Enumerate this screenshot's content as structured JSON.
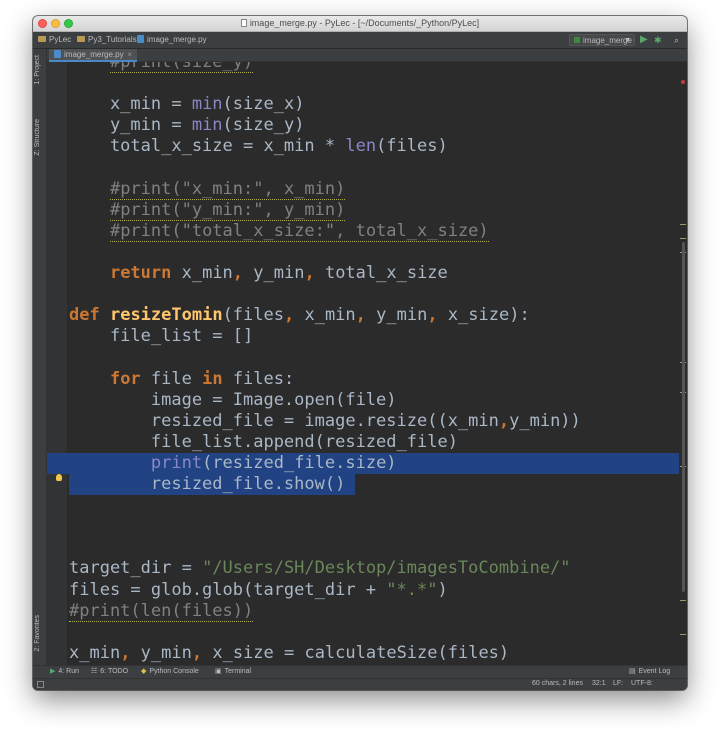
{
  "window": {
    "title": "image_merge.py - PyLec - [~/Documents/_Python/PyLec]"
  },
  "navbar": {
    "crumbs": [
      "PyLec",
      "Py3_Tutorials",
      "image_merge.py"
    ],
    "run_config": "image_merge"
  },
  "tabs": [
    {
      "label": "image_merge.py",
      "close": "×"
    }
  ],
  "left_tools": [
    {
      "label": "1: Project"
    },
    {
      "label": "Z: Structure"
    },
    {
      "label": "2: Favorites"
    }
  ],
  "editor": {
    "lines": [
      {
        "id": "l0",
        "html": "    <span class=\"cm sq\">#print(size_y)</span>"
      },
      {
        "id": "l1",
        "html": ""
      },
      {
        "id": "l2",
        "html": "    x_min = <span class=\"bi\">min</span>(size_x)"
      },
      {
        "id": "l3",
        "html": "    y_min = <span class=\"bi\">min</span>(size_y)"
      },
      {
        "id": "l4",
        "html": "    total_x_size = x_min * <span class=\"bi\">len</span>(files)"
      },
      {
        "id": "l5",
        "html": ""
      },
      {
        "id": "l6",
        "html": "    <span class=\"cm sq\">#print(\"x_min:\", x_min)</span>"
      },
      {
        "id": "l7",
        "html": "    <span class=\"cm sq\">#print(\"y_min:\", y_min)</span>"
      },
      {
        "id": "l8",
        "html": "    <span class=\"cm sq\">#print(\"total_x_size:\", total_x_size)</span>"
      },
      {
        "id": "l9",
        "html": ""
      },
      {
        "id": "l10",
        "html": "    <span class=\"kw\">return</span> x_min<span class=\"kw\">,</span> y_min<span class=\"kw\">,</span> total_x_size"
      },
      {
        "id": "l11",
        "html": ""
      },
      {
        "id": "l12",
        "html": "<span class=\"kw\">def</span> <span class=\"fn\">resizeTomin</span>(files<span class=\"kw\">,</span> x_min<span class=\"kw\">,</span> y_min<span class=\"kw\">,</span> x_size):"
      },
      {
        "id": "l13",
        "html": "    file_list = []"
      },
      {
        "id": "l14",
        "html": ""
      },
      {
        "id": "l15",
        "html": "    <span class=\"kw\">for</span> file <span class=\"kw\">in</span> files:"
      },
      {
        "id": "l16",
        "html": "        image = Image.open(file)"
      },
      {
        "id": "l17",
        "html": "        resized_file = image.resize((x_min<span class=\"kw\">,</span>y_min))"
      },
      {
        "id": "l18",
        "html": "        file_list.append(resized_file)"
      },
      {
        "id": "l19",
        "html": "        <span class=\"bi\">print</span>(resized_file.size)",
        "selected": true
      },
      {
        "id": "l20",
        "html": "        resized_file.show()",
        "selected_partial": true
      },
      {
        "id": "l21",
        "html": ""
      },
      {
        "id": "l22",
        "html": ""
      },
      {
        "id": "l23",
        "html": ""
      },
      {
        "id": "l24",
        "html": "target_dir = <span class=\"str\">\"/Users/SH/Desktop/imagesToCombine/\"</span>"
      },
      {
        "id": "l25",
        "html": "files = glob.glob(target_dir + <span class=\"str\">\"*.*\"</span>)"
      },
      {
        "id": "l26",
        "html": "<span class=\"cm sq\">#print(len(files))</span>"
      },
      {
        "id": "l27",
        "html": ""
      },
      {
        "id": "l28",
        "html": "x_min<span class=\"kw\">,</span> y_min<span class=\"kw\">,</span> x_size = calculateSize(files)"
      }
    ]
  },
  "bottom_tools": [
    {
      "label": "4: Run",
      "icon": "play-icon"
    },
    {
      "label": "6: TODO",
      "icon": "todo-icon"
    },
    {
      "label": "Python Console",
      "icon": "python-console-icon"
    },
    {
      "label": "Terminal",
      "icon": "terminal-icon"
    }
  ],
  "event_log": "Event Log",
  "status": {
    "selection": "60 chars, 2 lines",
    "position": "32:1",
    "line_sep": "LF:",
    "encoding": "UTF-8:"
  },
  "colors": {
    "keyword": "#cc7832",
    "builtin": "#8888c6",
    "function": "#ffc66d",
    "string": "#6a8759",
    "comment": "#808080",
    "selection": "#214283"
  }
}
